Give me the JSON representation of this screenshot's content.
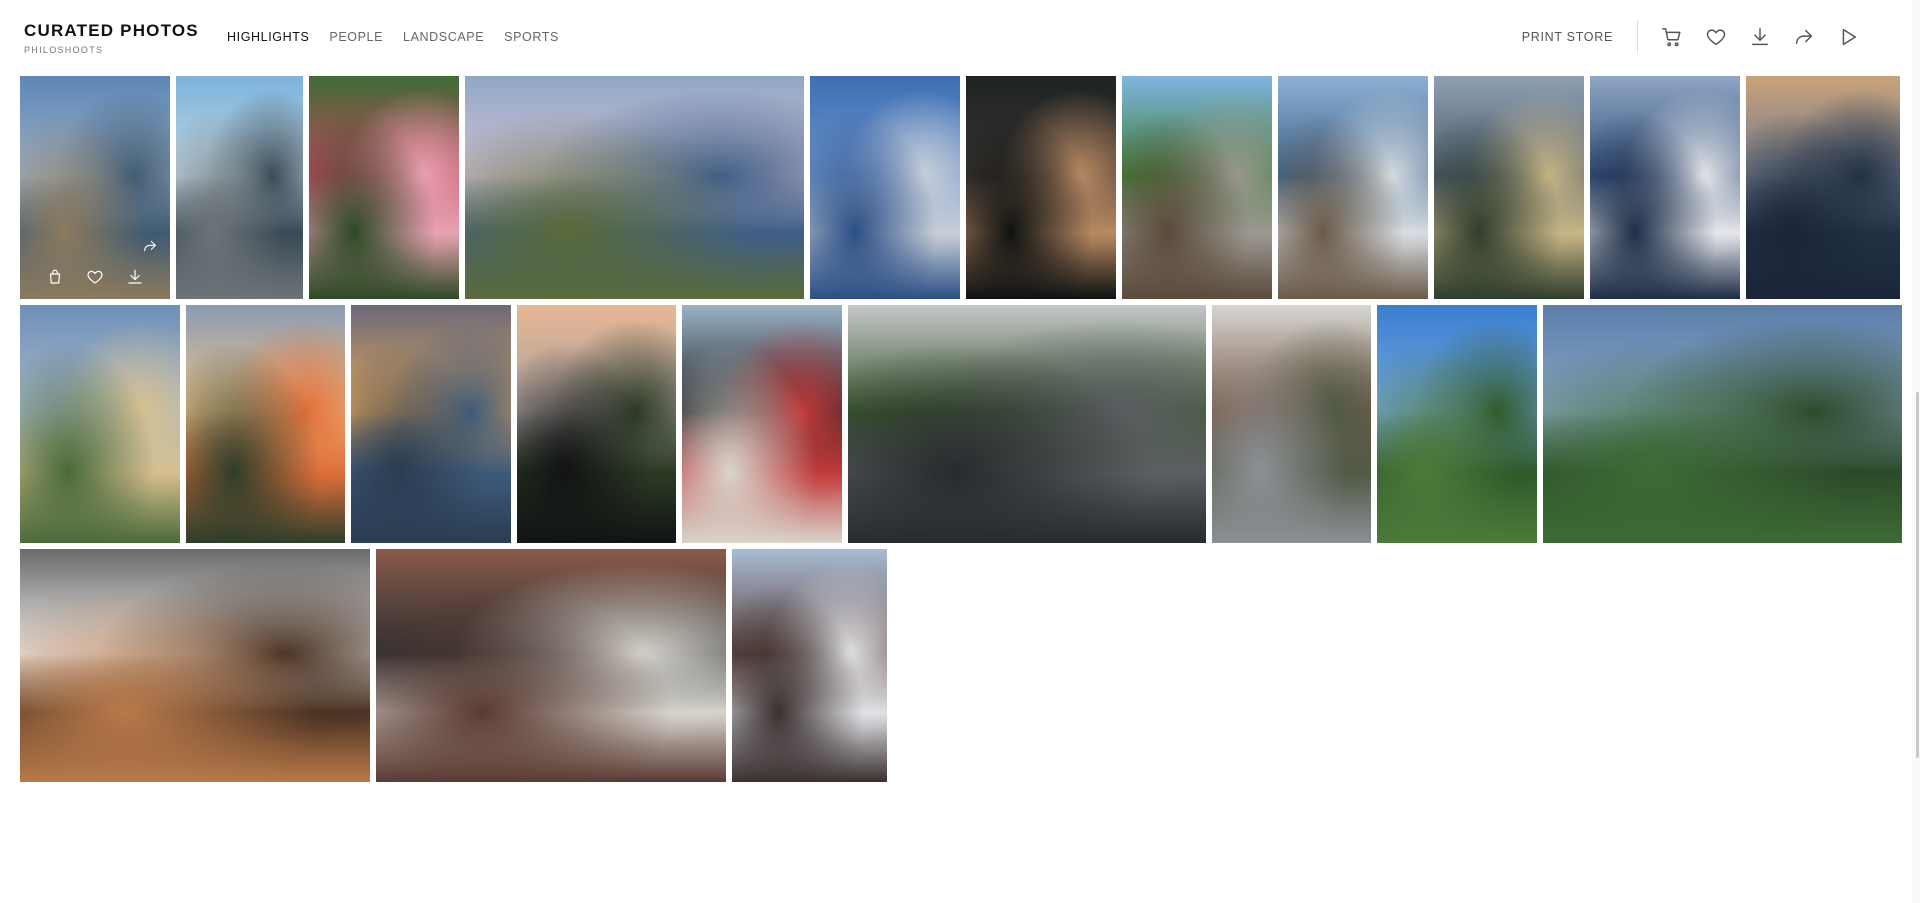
{
  "brand": {
    "title": "CURATED PHOTOS",
    "subtitle": "PHILOSHOOTS"
  },
  "nav": [
    {
      "label": "HIGHLIGHTS",
      "active": true
    },
    {
      "label": "PEOPLE",
      "active": false
    },
    {
      "label": "LANDSCAPE",
      "active": false
    },
    {
      "label": "SPORTS",
      "active": false
    }
  ],
  "actions": {
    "print_store": "PRINT STORE",
    "icons": [
      "cart-icon",
      "heart-icon",
      "download-icon",
      "share-icon",
      "play-icon"
    ]
  },
  "gallery": {
    "rows": [
      [
        {
          "subject": "toronto-skyline-from-shore",
          "colors": [
            "#5c86b8",
            "#9fb2c4",
            "#3f5a72",
            "#8b7a5e"
          ]
        },
        {
          "subject": "cyclists-by-pavilion",
          "colors": [
            "#7cb3d9",
            "#c5d7e2",
            "#3a4a55",
            "#6d7478"
          ]
        },
        {
          "subject": "pink-tulips",
          "colors": [
            "#3f6b34",
            "#c44a63",
            "#e8a3b3",
            "#2d4a25"
          ]
        },
        {
          "subject": "cherry-blossoms-by-lake",
          "colors": [
            "#90a8c5",
            "#d4c2d8",
            "#3e5f86",
            "#5a6a3a"
          ]
        },
        {
          "subject": "cn-tower",
          "colors": [
            "#3d6fb3",
            "#6f95cc",
            "#c9cfd8",
            "#2b4f85"
          ]
        },
        {
          "subject": "pint-of-stout-pub",
          "colors": [
            "#1e2323",
            "#3a3430",
            "#b98a63",
            "#0f1212"
          ]
        },
        {
          "subject": "wooden-boardwalk-forest",
          "colors": [
            "#7fb5e0",
            "#3e7d33",
            "#9c9892",
            "#5a4a3a"
          ]
        },
        {
          "subject": "driftwood-on-lake",
          "colors": [
            "#8fb0d3",
            "#3a638c",
            "#d8dde2",
            "#6a5a48"
          ]
        },
        {
          "subject": "arch-bridge-towers",
          "colors": [
            "#8ea0b3",
            "#4c5a6a",
            "#c9b686",
            "#2e3d2c"
          ]
        },
        {
          "subject": "ferry-on-harbour",
          "colors": [
            "#8fa6c4",
            "#324e78",
            "#e7e8eb",
            "#1d2d47"
          ]
        },
        {
          "subject": "skyline-at-dusk",
          "colors": [
            "#c9a27a",
            "#6f7b8d",
            "#233145",
            "#1a2538"
          ]
        }
      ],
      [
        {
          "subject": "sandy-beach-umbrellas",
          "colors": [
            "#6e90b8",
            "#a9b9cb",
            "#d7bf8e",
            "#4a6a3a"
          ]
        },
        {
          "subject": "sunset-over-pond",
          "colors": [
            "#8a9cb2",
            "#f2c48a",
            "#e06f3a",
            "#2d3e2a"
          ]
        },
        {
          "subject": "sunset-over-pool",
          "colors": [
            "#6a6a7a",
            "#e8a95a",
            "#3e5a7a",
            "#2a3d52"
          ]
        },
        {
          "subject": "couple-at-dusk",
          "colors": [
            "#e7b894",
            "#a9a0a0",
            "#2b3a24",
            "#121414"
          ]
        },
        {
          "subject": "t-shirt-stand",
          "colors": [
            "#9ab2c4",
            "#1e1e22",
            "#c23a3a",
            "#d8d5cc"
          ]
        },
        {
          "subject": "street-crowd-cn-tower",
          "colors": [
            "#c5c7cb",
            "#3d5a2e",
            "#5b5e63",
            "#272b2d"
          ]
        },
        {
          "subject": "townhouses-street",
          "colors": [
            "#d6d6d2",
            "#7a5a48",
            "#4f5a45",
            "#8d9095"
          ]
        },
        {
          "subject": "skyline-over-park",
          "colors": [
            "#3a7fd1",
            "#75a7dc",
            "#2f5a2a",
            "#4e7a3a"
          ]
        },
        {
          "subject": "skyline-over-valley",
          "colors": [
            "#5b7faa",
            "#8ba6c5",
            "#2c4a2a",
            "#3d6b35"
          ]
        }
      ],
      [
        {
          "subject": "sleeping-cat-chair",
          "colors": [
            "#6a6a6a",
            "#efefef",
            "#4a3222",
            "#b97a4a"
          ]
        },
        {
          "subject": "glass-atrium-building",
          "colors": [
            "#8a5a4a",
            "#2a2e30",
            "#d7d4cd",
            "#5a3a32"
          ]
        },
        {
          "subject": "tall-tower-block",
          "colors": [
            "#a9bcd6",
            "#5a4038",
            "#e0e2e6",
            "#3a3030"
          ]
        }
      ]
    ],
    "overlay_icons": [
      "bag-icon",
      "heart-icon",
      "download-icon",
      "share-icon"
    ]
  }
}
